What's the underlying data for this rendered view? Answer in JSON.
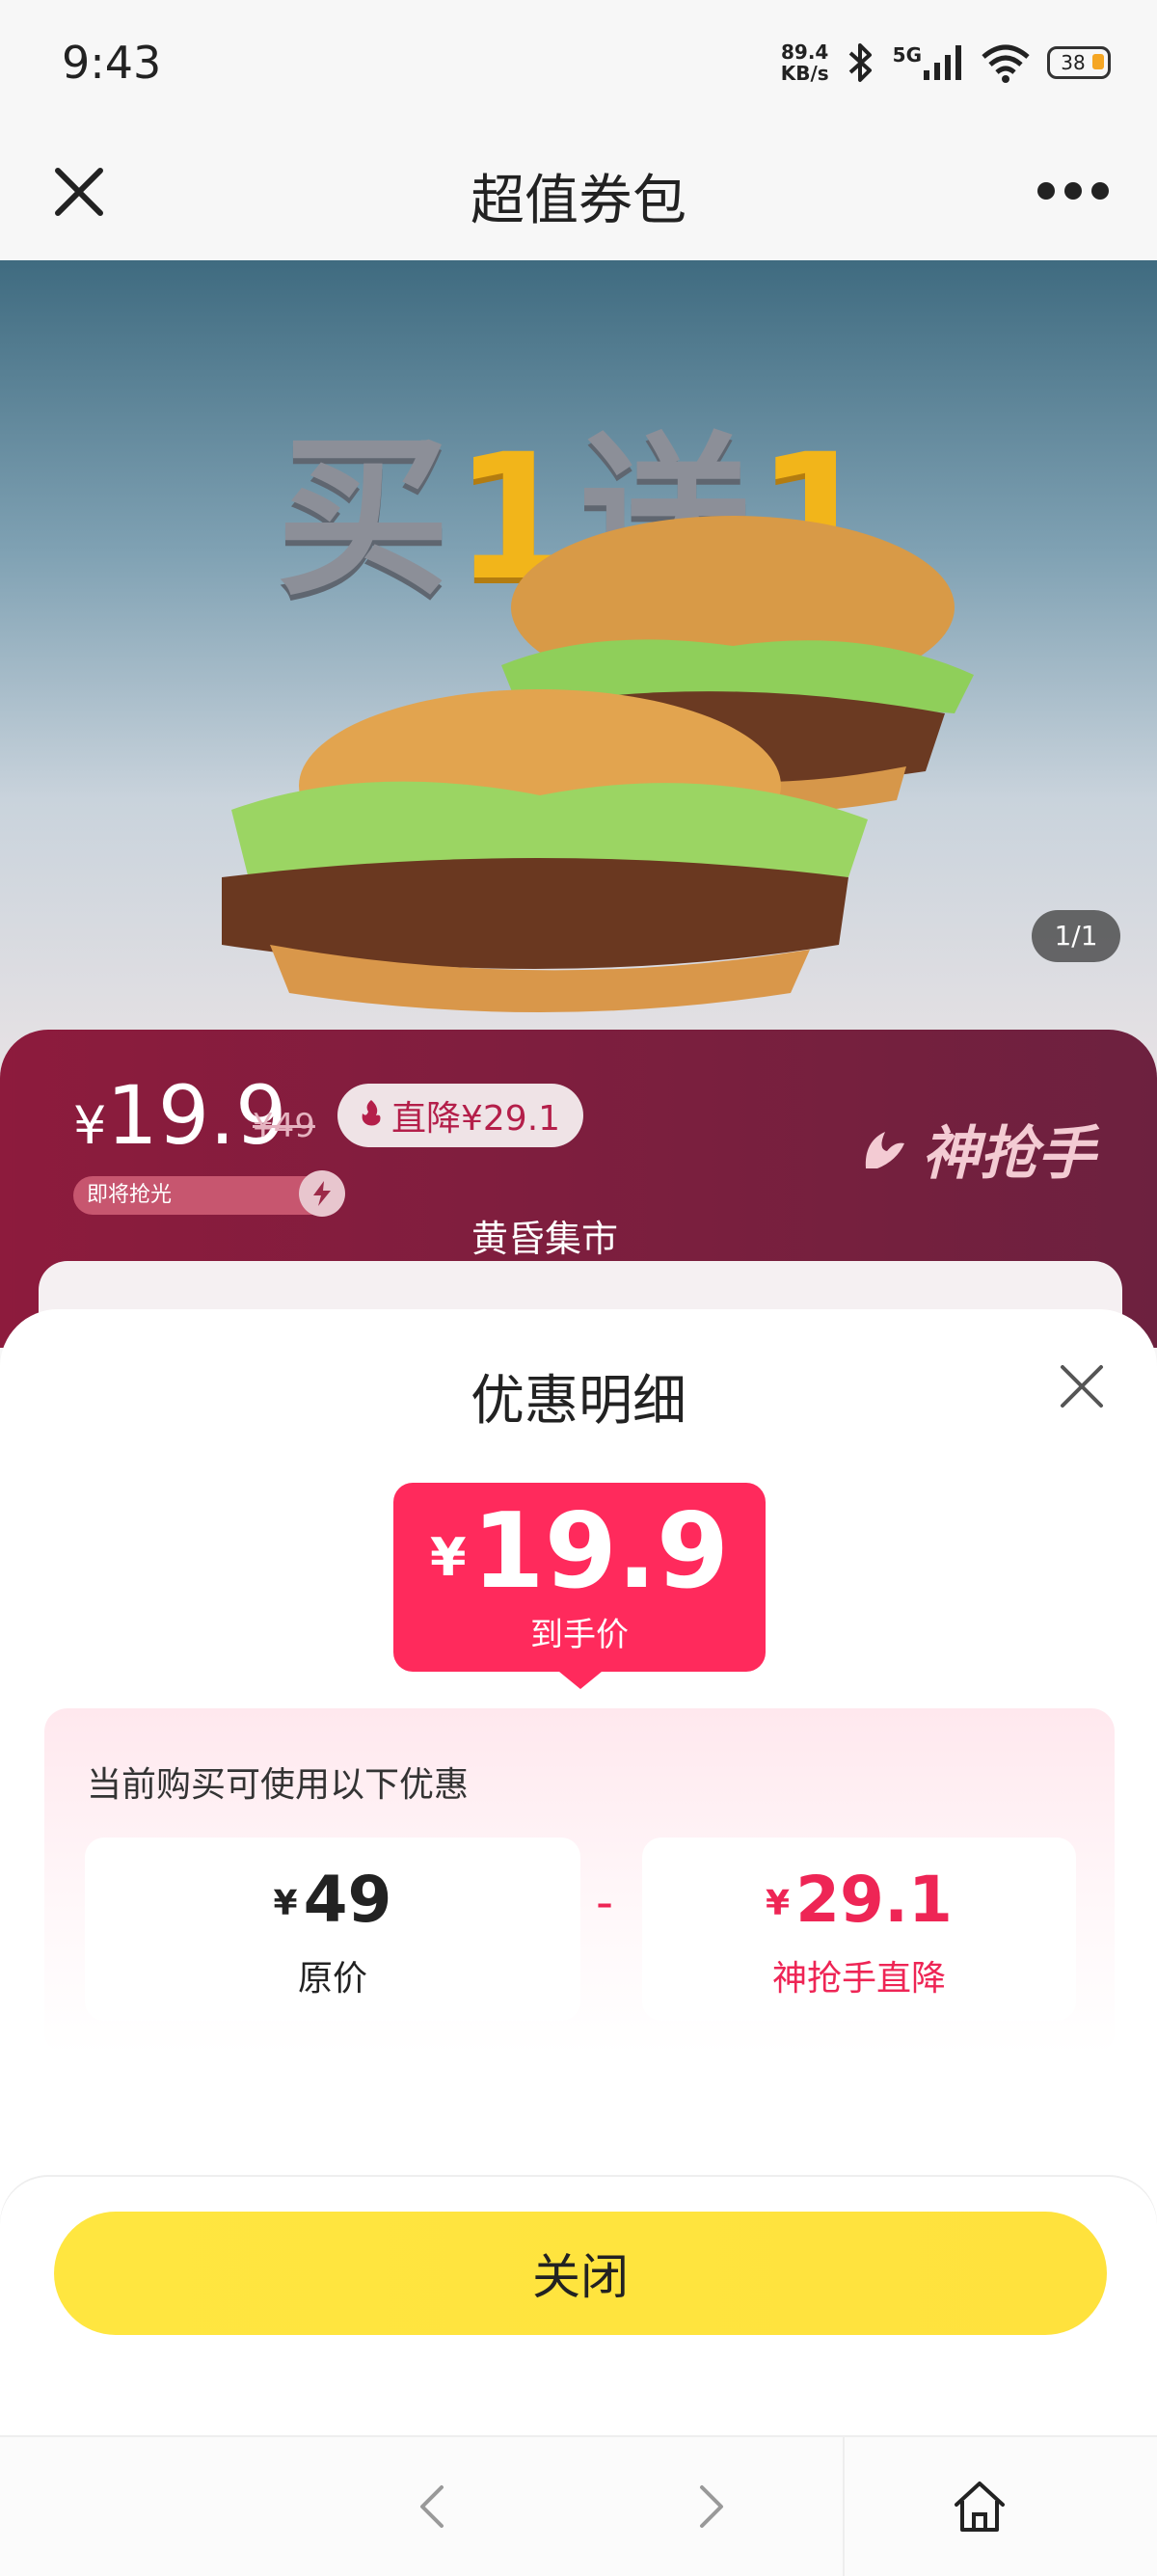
{
  "status_bar": {
    "time": "9:43",
    "net_speed_value": "89.4",
    "net_speed_unit": "KB/s",
    "network": "5G",
    "battery": "38",
    "icons": [
      "bluetooth-icon",
      "signal-icon",
      "wifi-icon",
      "battery-icon"
    ]
  },
  "navbar": {
    "title": "超值券包",
    "left_icon": "close-icon",
    "right_icon": "more-icon"
  },
  "hero": {
    "promo_text_part1": "买",
    "promo_text_num1": "1",
    "promo_text_part2": "送",
    "promo_text_num2": "1",
    "image_counter": "1/1"
  },
  "price_banner": {
    "yen": "¥",
    "price": "19.9",
    "original_price": "¥49",
    "drop_label": "直降¥29.1",
    "sale_status": "即将抢光",
    "brand": "神抢手",
    "market_label": "黄昏集市"
  },
  "sheet": {
    "title": "优惠明细",
    "final_price": {
      "yen": "¥",
      "amount": "19.9",
      "label": "到手价"
    },
    "discount_caption": "当前购买可使用以下优惠",
    "original": {
      "yen": "¥",
      "amount": "49",
      "label": "原价"
    },
    "operator": "-",
    "drop": {
      "yen": "¥",
      "amount": "29.1",
      "label": "神抢手直降"
    },
    "close_button": "关闭"
  },
  "colors": {
    "accent_red": "#ff2a5c",
    "banner_crimson": "#8d1b3d",
    "button_yellow": "#ffe640"
  }
}
